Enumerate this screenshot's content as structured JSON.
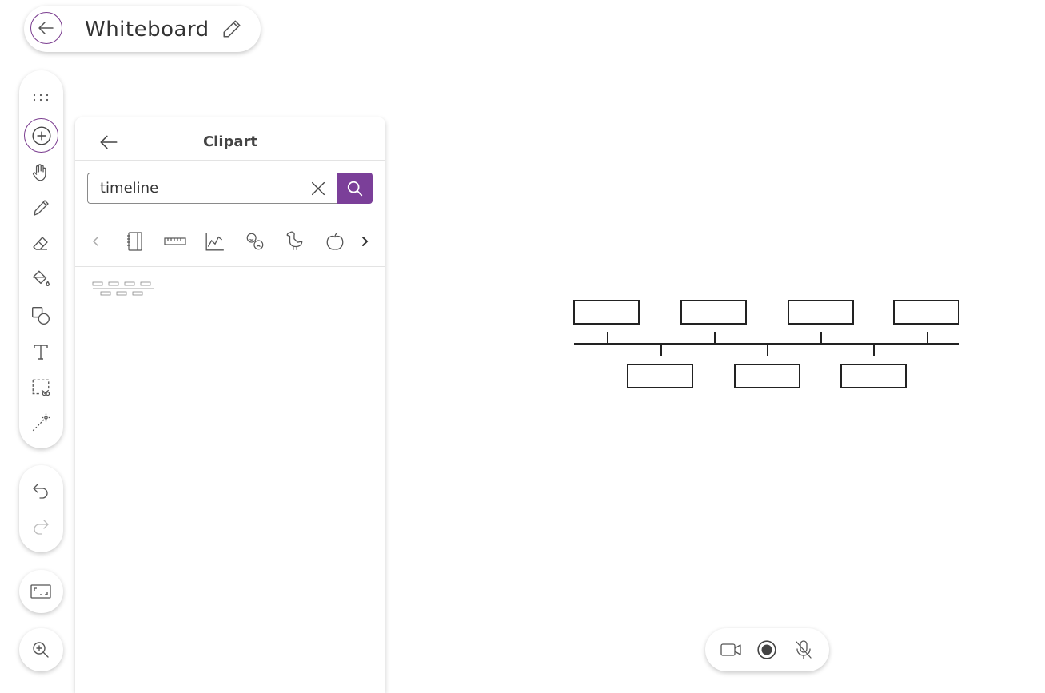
{
  "header": {
    "title": "Whiteboard",
    "back_icon": "arrow-left-icon",
    "edit_icon": "pencil-icon"
  },
  "toolbar": {
    "tools": [
      {
        "name": "drag-handle",
        "icon": "grip-dots-icon"
      },
      {
        "name": "add",
        "icon": "plus-circle-icon",
        "active": true
      },
      {
        "name": "pan",
        "icon": "hand-icon"
      },
      {
        "name": "pen",
        "icon": "pen-icon"
      },
      {
        "name": "eraser",
        "icon": "eraser-icon"
      },
      {
        "name": "fill",
        "icon": "paint-bucket-icon"
      },
      {
        "name": "shapes",
        "icon": "shapes-icon"
      },
      {
        "name": "text",
        "icon": "text-icon"
      },
      {
        "name": "select",
        "icon": "lasso-select-icon"
      },
      {
        "name": "laser",
        "icon": "laser-pointer-icon"
      }
    ],
    "history": [
      {
        "name": "undo",
        "icon": "undo-icon",
        "enabled": true
      },
      {
        "name": "redo",
        "icon": "redo-icon",
        "enabled": false
      }
    ],
    "view_icon": "fit-screen-icon",
    "zoom_icon": "zoom-in-icon"
  },
  "panel": {
    "title": "Clipart",
    "search": {
      "value": "timeline",
      "placeholder": ""
    },
    "categories": [
      "notebook-icon",
      "ruler-icon",
      "chart-icon",
      "emotions-icon",
      "bird-icon",
      "apple-icon"
    ],
    "results": [
      "timeline-clipart"
    ]
  },
  "media": {
    "camera_icon": "video-camera-icon",
    "record_icon": "record-icon",
    "mic_icon": "mic-muted-icon"
  },
  "colors": {
    "accent": "#7b3f99",
    "icon": "#555555",
    "disabled": "#bdbdbd"
  }
}
